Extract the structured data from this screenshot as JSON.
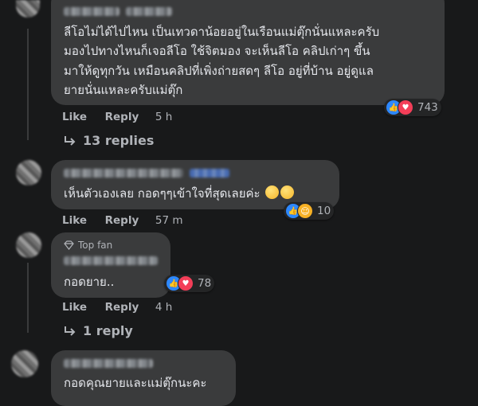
{
  "comments": [
    {
      "text_lines": [
        "ลีโอไม่ได้ไปไหน เป็นเทวดาน้อยอยู่ในเรือนแม่ตุ๊กนั่นแหละครับ",
        "มองไปทางไหนก็เจอลีโอ ใช้จิตมอง จะเห็นลีโอ คลิปเก่าๆ ขึ้น",
        "มาให้ดูทุกวัน เหมือนคลิปที่เพิ่งถ่ายสดๆ ลีโอ อยู่ที่บ้าน อยู่ดูแล",
        "ยายนั่นแหละครับแม่ตุ๊ก"
      ],
      "reaction_count": "743",
      "like_label": "Like",
      "reply_label": "Reply",
      "time": "5 h",
      "replies_label": "13 replies"
    },
    {
      "text": "เห็นตัวเองเลย กอดๆๆเข้าใจที่สุดเลยค่ะ",
      "reaction_count": "10",
      "like_label": "Like",
      "reply_label": "Reply",
      "time": "57 m"
    },
    {
      "badge": "Top fan",
      "text": "กอดยาย..",
      "reaction_count": "78",
      "like_label": "Like",
      "reply_label": "Reply",
      "time": "4 h",
      "replies_label": "1 reply"
    },
    {
      "text": "กอดคุณยายและแม่ตุ๊กนะคะ"
    }
  ],
  "colors": {
    "background": "#18191a",
    "bubble": "#3a3b3c",
    "text": "#e4e6eb",
    "secondary_text": "#b0b3b8",
    "like_blue": "#2d88ff",
    "love_red": "#f33e58"
  },
  "icons": [
    "like-reaction-icon",
    "love-reaction-icon",
    "care-reaction-icon",
    "reply-arrow-icon",
    "top-fan-diamond-icon"
  ]
}
